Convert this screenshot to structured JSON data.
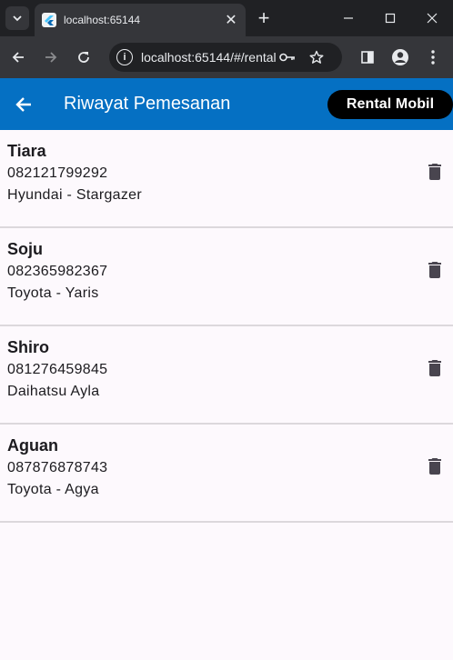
{
  "browser": {
    "tab": {
      "title": "localhost:65144"
    },
    "address_bar": {
      "url": "localhost:65144/#/rental"
    }
  },
  "appbar": {
    "title": "Riwayat Pemesanan",
    "action_label": "Rental Mobil",
    "color": "#0570c3"
  },
  "orders": [
    {
      "name": "Tiara",
      "phone": "082121799292",
      "car": "Hyundai - Stargazer"
    },
    {
      "name": "Soju",
      "phone": "082365982367",
      "car": "Toyota - Yaris"
    },
    {
      "name": "Shiro",
      "phone": "081276459845",
      "car": "Daihatsu Ayla"
    },
    {
      "name": "Aguan",
      "phone": "087876878743",
      "car": "Toyota - Agya"
    }
  ],
  "icons": {
    "row_action": "delete-icon",
    "back": "arrow-back-icon"
  }
}
